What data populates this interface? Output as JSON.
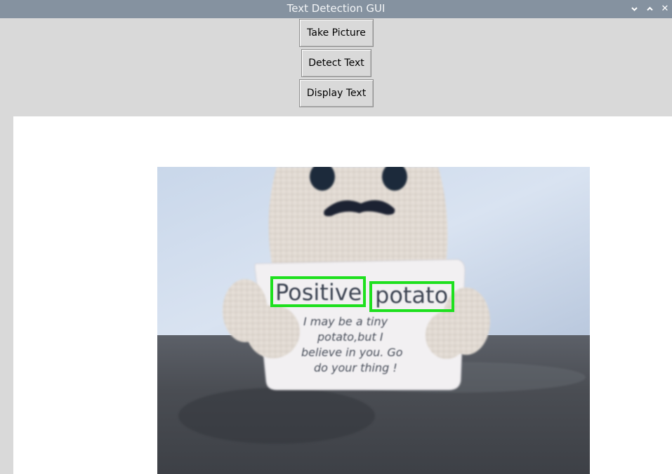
{
  "window": {
    "title": "Text Detection GUI",
    "controls": [
      "minimize",
      "maximize",
      "close"
    ],
    "close_glyph": "✕"
  },
  "buttons": {
    "take_picture": "Take Picture",
    "detect_text": "Detect Text",
    "display_text": "Display Text"
  },
  "photo": {
    "card_detected_words": [
      "Positive",
      "potato"
    ],
    "card_body_lines": [
      "I may be a tiny",
      "potato,but I",
      "believe in you. Go",
      "do your thing !"
    ],
    "box_color": "#1ee01e"
  },
  "colors": {
    "titlebar": "#8592a0",
    "window_bg": "#d9d9d9",
    "canvas_bg": "#ffffff"
  }
}
